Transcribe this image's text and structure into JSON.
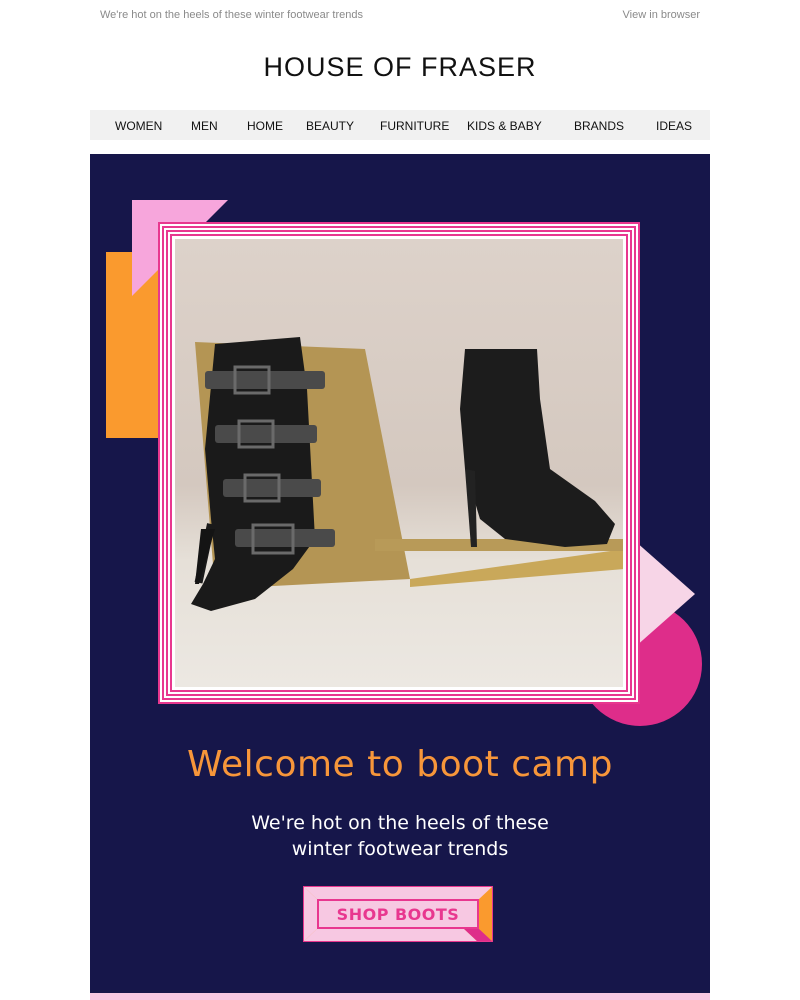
{
  "preheader": {
    "text": "We're hot on the heels of these winter footwear trends",
    "view_in_browser": "View in browser"
  },
  "brand": {
    "logo_text": "HOUSE OF FRASER"
  },
  "nav": {
    "items": [
      "WOMEN",
      "MEN",
      "HOME",
      "BEAUTY",
      "FURNITURE",
      "KIDS & BABY",
      "BRANDS",
      "IDEAS"
    ]
  },
  "hero": {
    "headline": "Welcome to boot camp",
    "subtext_line1": "We're hot on the heels of these",
    "subtext_line2": "winter footwear trends",
    "cta_label": "SHOP BOOTS",
    "image_icon": "ankle-boots-photo"
  },
  "colors": {
    "hero_background": "#16164a",
    "headline": "#f7963a",
    "accent_pink": "#e8378f",
    "accent_orange": "#fa9a2e",
    "light_pink": "#f7a6dc"
  }
}
